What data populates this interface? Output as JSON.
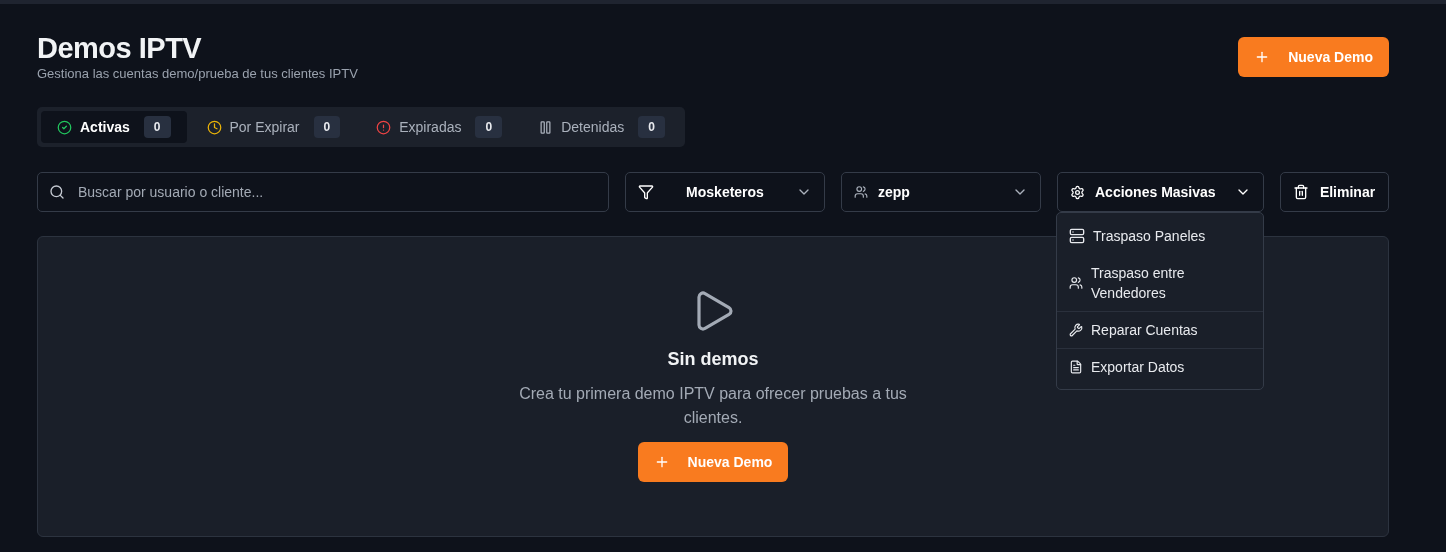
{
  "header": {
    "title": "Demos IPTV",
    "subtitle": "Gestiona las cuentas demo/prueba de tus clientes IPTV",
    "new_button": "Nueva Demo"
  },
  "tabs": [
    {
      "kind": "active",
      "label": "Activas",
      "count": "0",
      "selected": true
    },
    {
      "kind": "expiring",
      "label": "Por Expirar",
      "count": "0",
      "selected": false
    },
    {
      "kind": "expired",
      "label": "Expiradas",
      "count": "0",
      "selected": false
    },
    {
      "kind": "stopped",
      "label": "Detenidas",
      "count": "0",
      "selected": false
    }
  ],
  "filters": {
    "search": {
      "placeholder": "Buscar por usuario o cliente..."
    },
    "panel_select": {
      "value": "Mosketeros"
    },
    "seller_select": {
      "value": "zepp"
    },
    "bulk_actions": {
      "label": "Acciones Masivas",
      "expanded": true
    },
    "delete_button": "Eliminar"
  },
  "bulk_menu": [
    {
      "kind": "panels",
      "label": "Traspaso Paneles",
      "separated": false
    },
    {
      "kind": "sellers",
      "label": "Traspaso entre Vendedores",
      "separated": false
    },
    {
      "kind": "repair",
      "label": "Reparar Cuentas",
      "separated": true
    },
    {
      "kind": "export",
      "label": "Exportar Datos",
      "separated": true
    }
  ],
  "empty_state": {
    "title": "Sin demos",
    "message": "Crea tu primera demo IPTV para ofrecer pruebas a tus clientes.",
    "button": "Nueva Demo"
  }
}
